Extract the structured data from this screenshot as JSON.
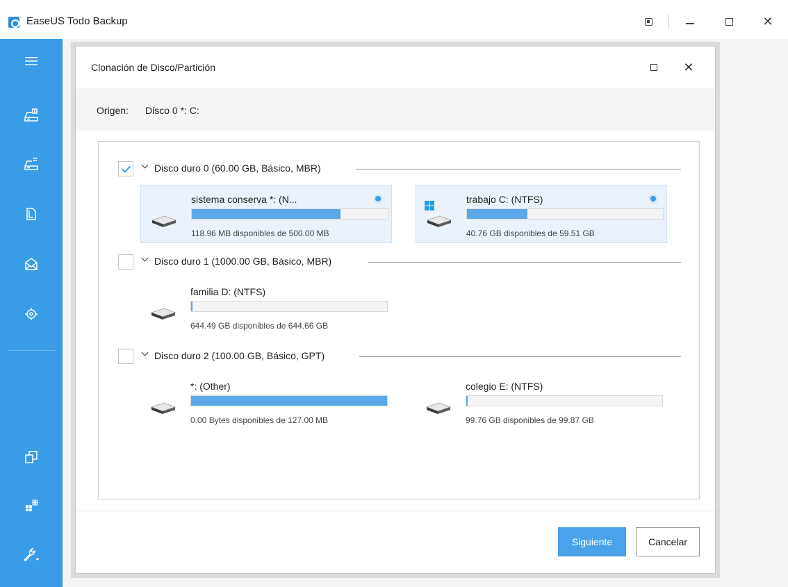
{
  "app": {
    "title": "EaseUS Todo Backup",
    "accent_color": "#3a9be6"
  },
  "sidebar": {
    "items": [
      {
        "icon": "hamburger-menu-icon"
      },
      {
        "icon": "disk-backup-icon"
      },
      {
        "icon": "system-backup-icon"
      },
      {
        "icon": "file-backup-icon"
      },
      {
        "icon": "mail-backup-icon"
      },
      {
        "icon": "smart-backup-icon"
      },
      {
        "icon": "clone-icon"
      },
      {
        "icon": "apps-icon"
      },
      {
        "icon": "tools-icon"
      }
    ]
  },
  "dialog": {
    "title": "Clonación de Disco/Partición",
    "origin_label": "Origen:",
    "origin_value": "Disco 0 *: C:",
    "next_label": "Siguiente",
    "cancel_label": "Cancelar"
  },
  "disks": [
    {
      "label": "Disco duro 0 (60.00 GB, Básico, MBR)",
      "checked": true,
      "partitions": [
        {
          "name": "sistema conserva *: (N...",
          "info": "118.96 MB disponibles de 500.00 MB",
          "used_fraction": 0.76,
          "selected": true,
          "windows": false
        },
        {
          "name": "trabajo C: (NTFS)",
          "info": "40.76 GB disponibles de 59.51 GB",
          "used_fraction": 0.31,
          "selected": true,
          "windows": true
        }
      ]
    },
    {
      "label": "Disco duro 1 (1000.00 GB, Básico, MBR)",
      "checked": false,
      "partitions": [
        {
          "name": "familia D: (NTFS)",
          "info": "644.49 GB disponibles de 644.66 GB",
          "used_fraction": 0.003,
          "selected": false,
          "windows": false
        }
      ]
    },
    {
      "label": "Disco duro 2 (100.00 GB, Básico, GPT)",
      "checked": false,
      "partitions": [
        {
          "name": "*: (Other)",
          "info": "0.00 Bytes disponibles de 127.00 MB",
          "used_fraction": 1.0,
          "selected": false,
          "windows": false
        },
        {
          "name": "colegio E: (NTFS)",
          "info": "99.76 GB disponibles de 99.87 GB",
          "used_fraction": 0.004,
          "selected": false,
          "windows": false
        }
      ]
    }
  ]
}
